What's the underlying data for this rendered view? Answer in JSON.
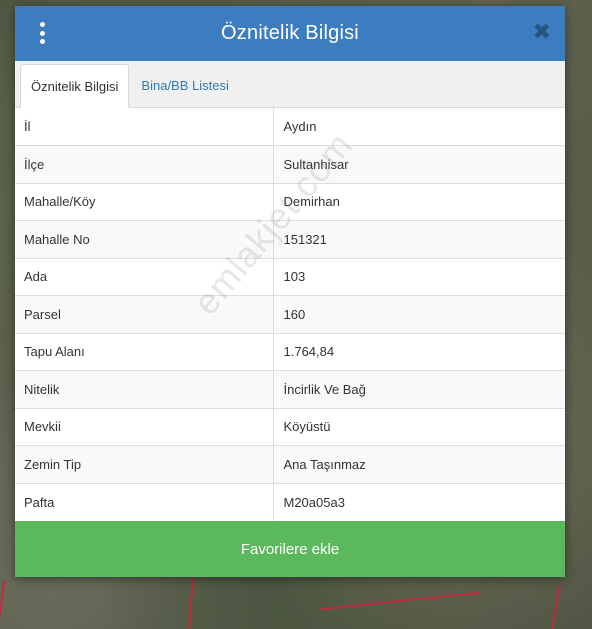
{
  "header": {
    "title": "Öznitelik Bilgisi",
    "menu_icon": "kebab-menu-icon",
    "close_glyph": "✖"
  },
  "tabs": [
    {
      "label": "Öznitelik Bilgisi",
      "active": true
    },
    {
      "label": "Bina/BB Listesi",
      "active": false
    }
  ],
  "attributes": [
    {
      "key": "İl",
      "value": "Aydın"
    },
    {
      "key": "İlçe",
      "value": "Sultanhisar"
    },
    {
      "key": "Mahalle/Köy",
      "value": "Demirhan"
    },
    {
      "key": "Mahalle No",
      "value": "151321"
    },
    {
      "key": "Ada",
      "value": "103"
    },
    {
      "key": "Parsel",
      "value": "160"
    },
    {
      "key": "Tapu Alanı",
      "value": "1.764,84"
    },
    {
      "key": "Nitelik",
      "value": "İncirlik Ve Bağ"
    },
    {
      "key": "Mevkii",
      "value": "Köyüstü"
    },
    {
      "key": "Zemin Tip",
      "value": "Ana Taşınmaz"
    },
    {
      "key": "Pafta",
      "value": "M20a05a3"
    }
  ],
  "watermark": "emlakjet.com",
  "footer": {
    "favorite_label": "Favorilere ekle"
  },
  "colors": {
    "header": "#3c7dc0",
    "favorite_button": "#5cb85c",
    "tab_link": "#337ab7",
    "parcel_border": "#d0243a"
  }
}
